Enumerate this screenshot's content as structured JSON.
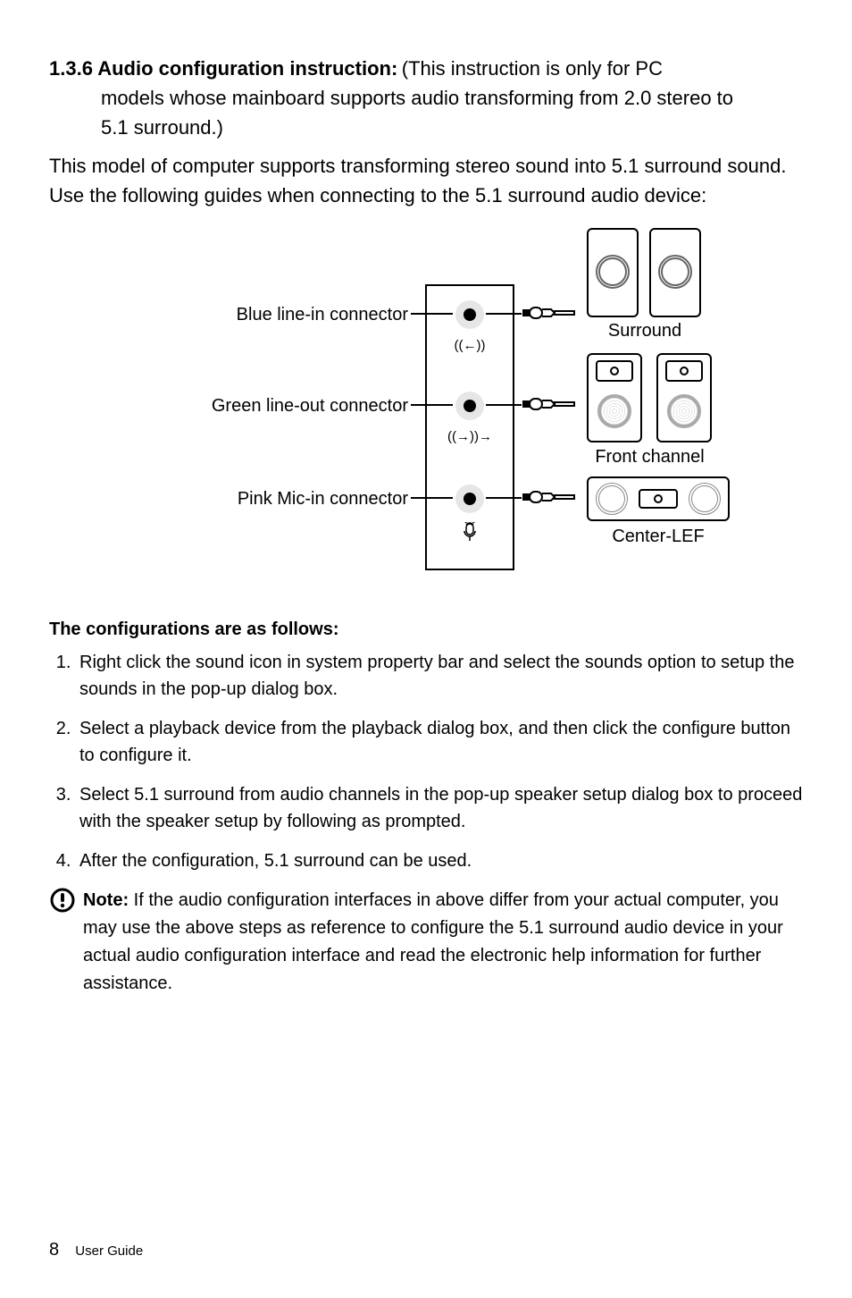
{
  "heading": {
    "number": "1.3.6",
    "title": "Audio configuration instruction:",
    "trailing": "(This instruction is only for PC",
    "cont1": "models whose mainboard supports audio transforming from 2.0 stereo to",
    "cont2": "5.1 surround.)"
  },
  "intro1": "This model of computer supports transforming stereo sound into 5.1 surround sound.",
  "intro2": "Use the following guides when connecting to the 5.1 surround audio device:",
  "diagram": {
    "blue": "Blue line-in connector",
    "green": "Green line-out connector",
    "pink": "Pink Mic-in connector",
    "surround": "Surround",
    "front": "Front channel",
    "center": "Center-LEF"
  },
  "config_head": "The configurations are as follows:",
  "steps": [
    "Right click the sound icon in system property bar and select the sounds option to setup the sounds in the pop-up dialog box.",
    "Select a playback device from the playback dialog box, and then click the configure button to configure it.",
    "Select 5.1 surround from audio channels in the pop-up speaker setup dialog box to proceed with the speaker setup by following as prompted.",
    "After the configuration, 5.1 surround can be used."
  ],
  "note_label": "Note:",
  "note_body": " If the audio configuration interfaces in above differ from your actual computer, you may use the above steps as reference to configure the 5.1 surround audio device in your actual audio configuration interface and read the electronic help information for further assistance.",
  "footer": {
    "page": "8",
    "guide": "User Guide"
  }
}
